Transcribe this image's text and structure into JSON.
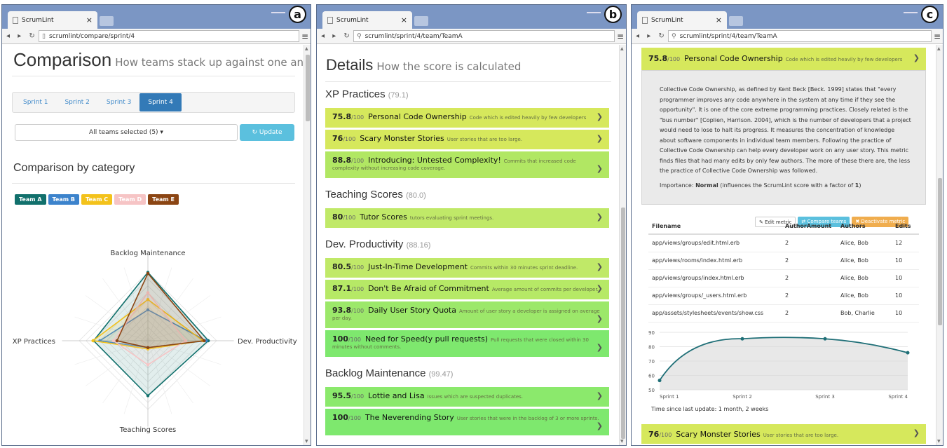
{
  "browser": {
    "tab_title": "ScrumLint",
    "tab_close": "×",
    "menu_icon": "≡"
  },
  "panel_a": {
    "label": "a",
    "url": "scrumlint/compare/sprint/4",
    "title": "Comparison",
    "subtitle": "How teams stack up against one another",
    "sprints": [
      "Sprint 1",
      "Sprint 2",
      "Sprint 3",
      "Sprint 4"
    ],
    "active_sprint": "Sprint 4",
    "team_select": "All teams selected (5) ▾",
    "update_button": "Update",
    "category_title": "Comparison by category",
    "teams": [
      {
        "name": "Team A",
        "color": "#11706c"
      },
      {
        "name": "Team B",
        "color": "#3c83cc"
      },
      {
        "name": "Team C",
        "color": "#f3c21b"
      },
      {
        "name": "Team D",
        "color": "#f6c4c5"
      },
      {
        "name": "Team E",
        "color": "#8b4513"
      }
    ],
    "chart_data": {
      "type": "radar",
      "axes": [
        "Backlog Maintenance",
        "Dev. Productivity",
        "Teaching Scores",
        "XP Practices"
      ],
      "max": 100,
      "series": [
        {
          "name": "Team A",
          "values": [
            99.5,
            88,
            80,
            79
          ]
        },
        {
          "name": "Team B",
          "values": [
            45,
            85,
            10,
            70
          ]
        },
        {
          "name": "Team C",
          "values": [
            60,
            80,
            12,
            80
          ]
        },
        {
          "name": "Team D",
          "values": [
            70,
            55,
            35,
            50
          ]
        },
        {
          "name": "Team E",
          "values": [
            98,
            82,
            10,
            45
          ]
        }
      ]
    }
  },
  "panel_b": {
    "label": "b",
    "url": "scrumlint/sprint/4/team/TeamA",
    "title": "Details",
    "subtitle": "How the score is calculated",
    "out_of": "/100",
    "sections": [
      {
        "name": "XP Practices",
        "score": "(79.1)",
        "metrics": [
          {
            "score": "75.8",
            "name": "Personal Code Ownership",
            "desc": "Code which is edited heavily by few developers",
            "color": "#d6e85c"
          },
          {
            "score": "76",
            "name": "Scary Monster Stories",
            "desc": "User stories that are too large.",
            "color": "#d6e85c"
          },
          {
            "score": "88.8",
            "name": "Introducing: Untested Complexity!",
            "desc": "Commits that increased code complexity without increasing code coverage.",
            "color": "#b1e763"
          }
        ]
      },
      {
        "name": "Teaching Scores",
        "score": "(80.0)",
        "metrics": [
          {
            "score": "80",
            "name": "Tutor Scores",
            "desc": "tutors evaluating sprint meetings.",
            "color": "#c0e968"
          }
        ]
      },
      {
        "name": "Dev. Productivity",
        "score": "(88.16)",
        "metrics": [
          {
            "score": "80.5",
            "name": "Just-In-Time Development",
            "desc": "Commits within 30 minutes sprint deadline.",
            "color": "#c0e968"
          },
          {
            "score": "87.1",
            "name": "Don't Be Afraid of Commitment",
            "desc": "Average amount of commits per developer.",
            "color": "#b6e966"
          },
          {
            "score": "93.8",
            "name": "Daily User Story Quota",
            "desc": "Amount of user story a developer is assigned on average per day.",
            "color": "#9ce86a"
          },
          {
            "score": "100",
            "name": "Need for Speed(y pull requests)",
            "desc": "Pull requests that were closed within 30 minutes without comments.",
            "color": "#7ee86e"
          }
        ]
      },
      {
        "name": "Backlog Maintenance",
        "score": "(99.47)",
        "metrics": [
          {
            "score": "95.5",
            "name": "Lottie and Lisa",
            "desc": "Issues which are suspected duplicates.",
            "color": "#8be96c"
          },
          {
            "score": "100",
            "name": "The Neverending Story",
            "desc": "User stories that were in the backlog of 3 or more sprints.",
            "color": "#7ee86e"
          }
        ]
      }
    ]
  },
  "panel_c": {
    "label": "c",
    "url": "scrumlint/sprint/4/team/TeamA",
    "header": {
      "score": "75.8",
      "out_of": "/100",
      "name": "Personal Code Ownership",
      "desc": "Code which is edited heavily by few developers"
    },
    "description": "Collective Code Ownership, as defined by Kent Beck [Beck. 1999] states that \"every programmer improves any code anywhere in the system at any time if they see the opportunity\". It is one of the core extreme programming practices. Closely related is the \"bus number\" [Coplien, Harrison. 2004], which is the number of developers that a project would need to lose to halt its progress. It measures the concentration of knowledge about software components in individual team members. Following the practice of Collective Code Ownership can help every developer work on any user story. This metric finds files that had many edits by only few authors. The more of these there are, the less the practice of Collective Code Ownership was followed.",
    "importance_label": "Importance:",
    "importance_value": "Normal",
    "importance_note_pre": "(influences the ScrumLint score with a factor of",
    "importance_factor": "1",
    "importance_note_post": ")",
    "buttons": {
      "edit": "Edit metric",
      "compare": "Compare teams",
      "deactivate": "Deactivate metric"
    },
    "table": {
      "headers": [
        "Filename",
        "AuthorAmount",
        "Authors",
        "Edits"
      ],
      "rows": [
        [
          "app/views/groups/edit.html.erb",
          "2",
          "Alice, Bob",
          "12"
        ],
        [
          "app/views/rooms/index.html.erb",
          "2",
          "Alice, Bob",
          "10"
        ],
        [
          "app/views/groups/index.html.erb",
          "2",
          "Alice, Bob",
          "10"
        ],
        [
          "app/views/groups/_users.html.erb",
          "2",
          "Alice, Bob",
          "10"
        ],
        [
          "app/assets/stylesheets/events/show.css",
          "2",
          "Bob, Charlie",
          "10"
        ]
      ]
    },
    "chart_data": {
      "type": "line",
      "categories": [
        "Sprint 1",
        "Sprint 2",
        "Sprint 3",
        "Sprint 4"
      ],
      "values": [
        56.5,
        85.5,
        85.5,
        75.8
      ],
      "ylim": [
        50,
        90
      ],
      "yticks": [
        "90",
        "80",
        "70",
        "60",
        "50"
      ]
    },
    "update_note": "Time since last update: 1 month, 2 weeks",
    "footer_metric": {
      "score": "76",
      "out_of": "/100",
      "name": "Scary Monster Stories",
      "desc": "User stories that are too large."
    }
  }
}
